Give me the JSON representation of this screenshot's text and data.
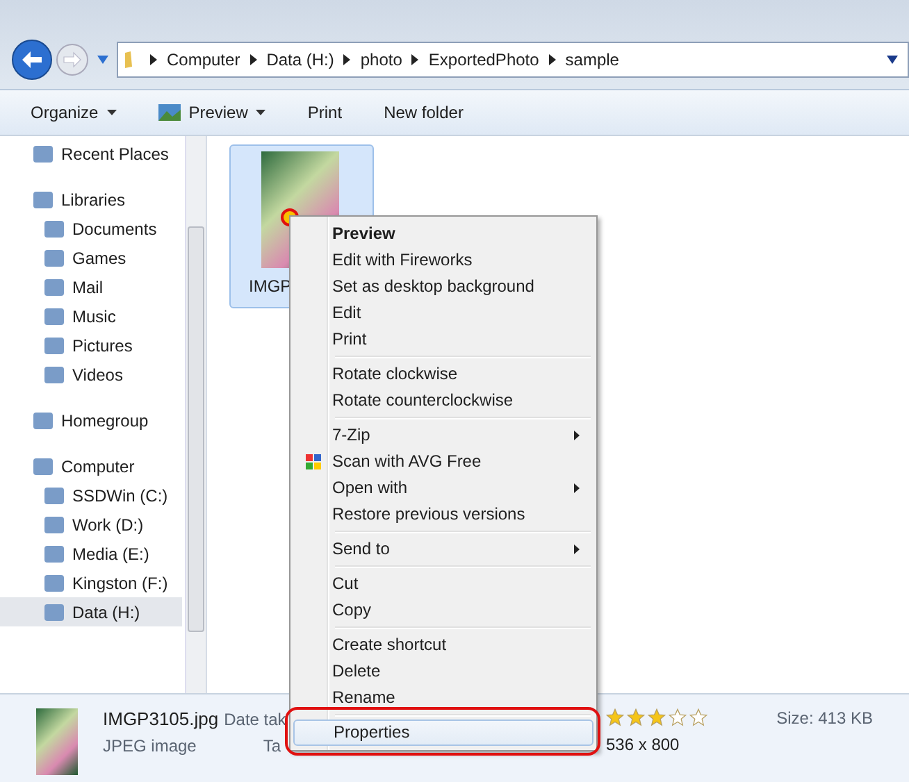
{
  "breadcrumb": [
    "Computer",
    "Data (H:)",
    "photo",
    "ExportedPhoto",
    "sample"
  ],
  "toolbar": [
    {
      "label": "Organize",
      "dropdown": true,
      "icon": false
    },
    {
      "label": "Preview",
      "dropdown": true,
      "icon": true
    },
    {
      "label": "Print",
      "dropdown": false,
      "icon": false
    },
    {
      "label": "New folder",
      "dropdown": false,
      "icon": false
    }
  ],
  "sidebar": {
    "items": [
      {
        "label": "Recent Places",
        "selected": false
      },
      {
        "label": "Libraries",
        "selected": false,
        "children": [
          {
            "label": "Documents",
            "selected": false
          },
          {
            "label": "Games",
            "selected": false
          },
          {
            "label": "Mail",
            "selected": false
          },
          {
            "label": "Music",
            "selected": false
          },
          {
            "label": "Pictures",
            "selected": false
          },
          {
            "label": "Videos",
            "selected": false
          }
        ]
      },
      {
        "label": "Homegroup",
        "selected": false
      },
      {
        "label": "Computer",
        "selected": false,
        "children": [
          {
            "label": "SSDWin (C:)",
            "selected": false
          },
          {
            "label": "Work (D:)",
            "selected": false
          },
          {
            "label": "Media (E:)",
            "selected": false
          },
          {
            "label": "Kingston (F:)",
            "selected": false
          },
          {
            "label": "Data (H:)",
            "selected": true
          }
        ]
      }
    ]
  },
  "file": {
    "name": "IMGP",
    "selected": true
  },
  "context_menu": {
    "groups": [
      [
        {
          "label": "Preview",
          "default": true,
          "submenu": false,
          "icon": false,
          "selected": false
        },
        {
          "label": "Edit with Fireworks",
          "default": false,
          "submenu": false,
          "icon": false,
          "selected": false
        },
        {
          "label": "Set as desktop background",
          "default": false,
          "submenu": false,
          "icon": false,
          "selected": false
        },
        {
          "label": "Edit",
          "default": false,
          "submenu": false,
          "icon": false,
          "selected": false
        },
        {
          "label": "Print",
          "default": false,
          "submenu": false,
          "icon": false,
          "selected": false
        }
      ],
      [
        {
          "label": "Rotate clockwise",
          "default": false,
          "submenu": false,
          "icon": false,
          "selected": false
        },
        {
          "label": "Rotate counterclockwise",
          "default": false,
          "submenu": false,
          "icon": false,
          "selected": false
        }
      ],
      [
        {
          "label": "7-Zip",
          "default": false,
          "submenu": true,
          "icon": false,
          "selected": false
        },
        {
          "label": "Scan with AVG Free",
          "default": false,
          "submenu": false,
          "icon": true,
          "selected": false
        },
        {
          "label": "Open with",
          "default": false,
          "submenu": true,
          "icon": false,
          "selected": false
        },
        {
          "label": "Restore previous versions",
          "default": false,
          "submenu": false,
          "icon": false,
          "selected": false
        }
      ],
      [
        {
          "label": "Send to",
          "default": false,
          "submenu": true,
          "icon": false,
          "selected": false
        }
      ],
      [
        {
          "label": "Cut",
          "default": false,
          "submenu": false,
          "icon": false,
          "selected": false
        },
        {
          "label": "Copy",
          "default": false,
          "submenu": false,
          "icon": false,
          "selected": false
        }
      ],
      [
        {
          "label": "Create shortcut",
          "default": false,
          "submenu": false,
          "icon": false,
          "selected": false
        },
        {
          "label": "Delete",
          "default": false,
          "submenu": false,
          "icon": false,
          "selected": false
        },
        {
          "label": "Rename",
          "default": false,
          "submenu": false,
          "icon": false,
          "selected": false
        }
      ],
      [
        {
          "label": "Properties",
          "default": false,
          "submenu": false,
          "icon": false,
          "selected": true
        }
      ]
    ]
  },
  "details": {
    "name": "IMGP3105.jpg",
    "date_label": "Date tak",
    "type": "JPEG image",
    "tags_label": "Ta",
    "stars": 3,
    "dimensions": "536 x 800",
    "size": "Size: 413 KB"
  }
}
